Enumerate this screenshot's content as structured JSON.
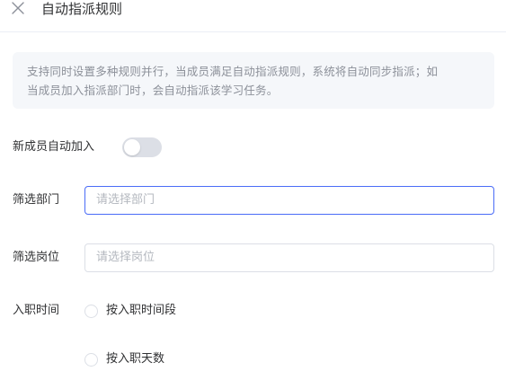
{
  "header": {
    "title": "自动指派规则",
    "close_icon": "close-icon"
  },
  "notice": {
    "line1": "支持同时设置多种规则并行，当成员满足自动指派规则，系统将自动同步指派；如",
    "line2": "当成员加入指派部门时，会自动指派该学习任务。"
  },
  "form": {
    "auto_join": {
      "label": "新成员自动加入",
      "enabled": false
    },
    "department": {
      "label": "筛选部门",
      "placeholder": "请选择部门"
    },
    "position": {
      "label": "筛选岗位",
      "placeholder": "请选择岗位"
    },
    "hire_time": {
      "label": "入职时间",
      "options": [
        {
          "label": "按入职时间段",
          "selected": false
        },
        {
          "label": "按入职天数",
          "selected": false
        }
      ]
    }
  },
  "colors": {
    "accent": "#4a6cf7",
    "notice_bg": "#f5f7fa",
    "switch_off": "#dcdfe6"
  }
}
